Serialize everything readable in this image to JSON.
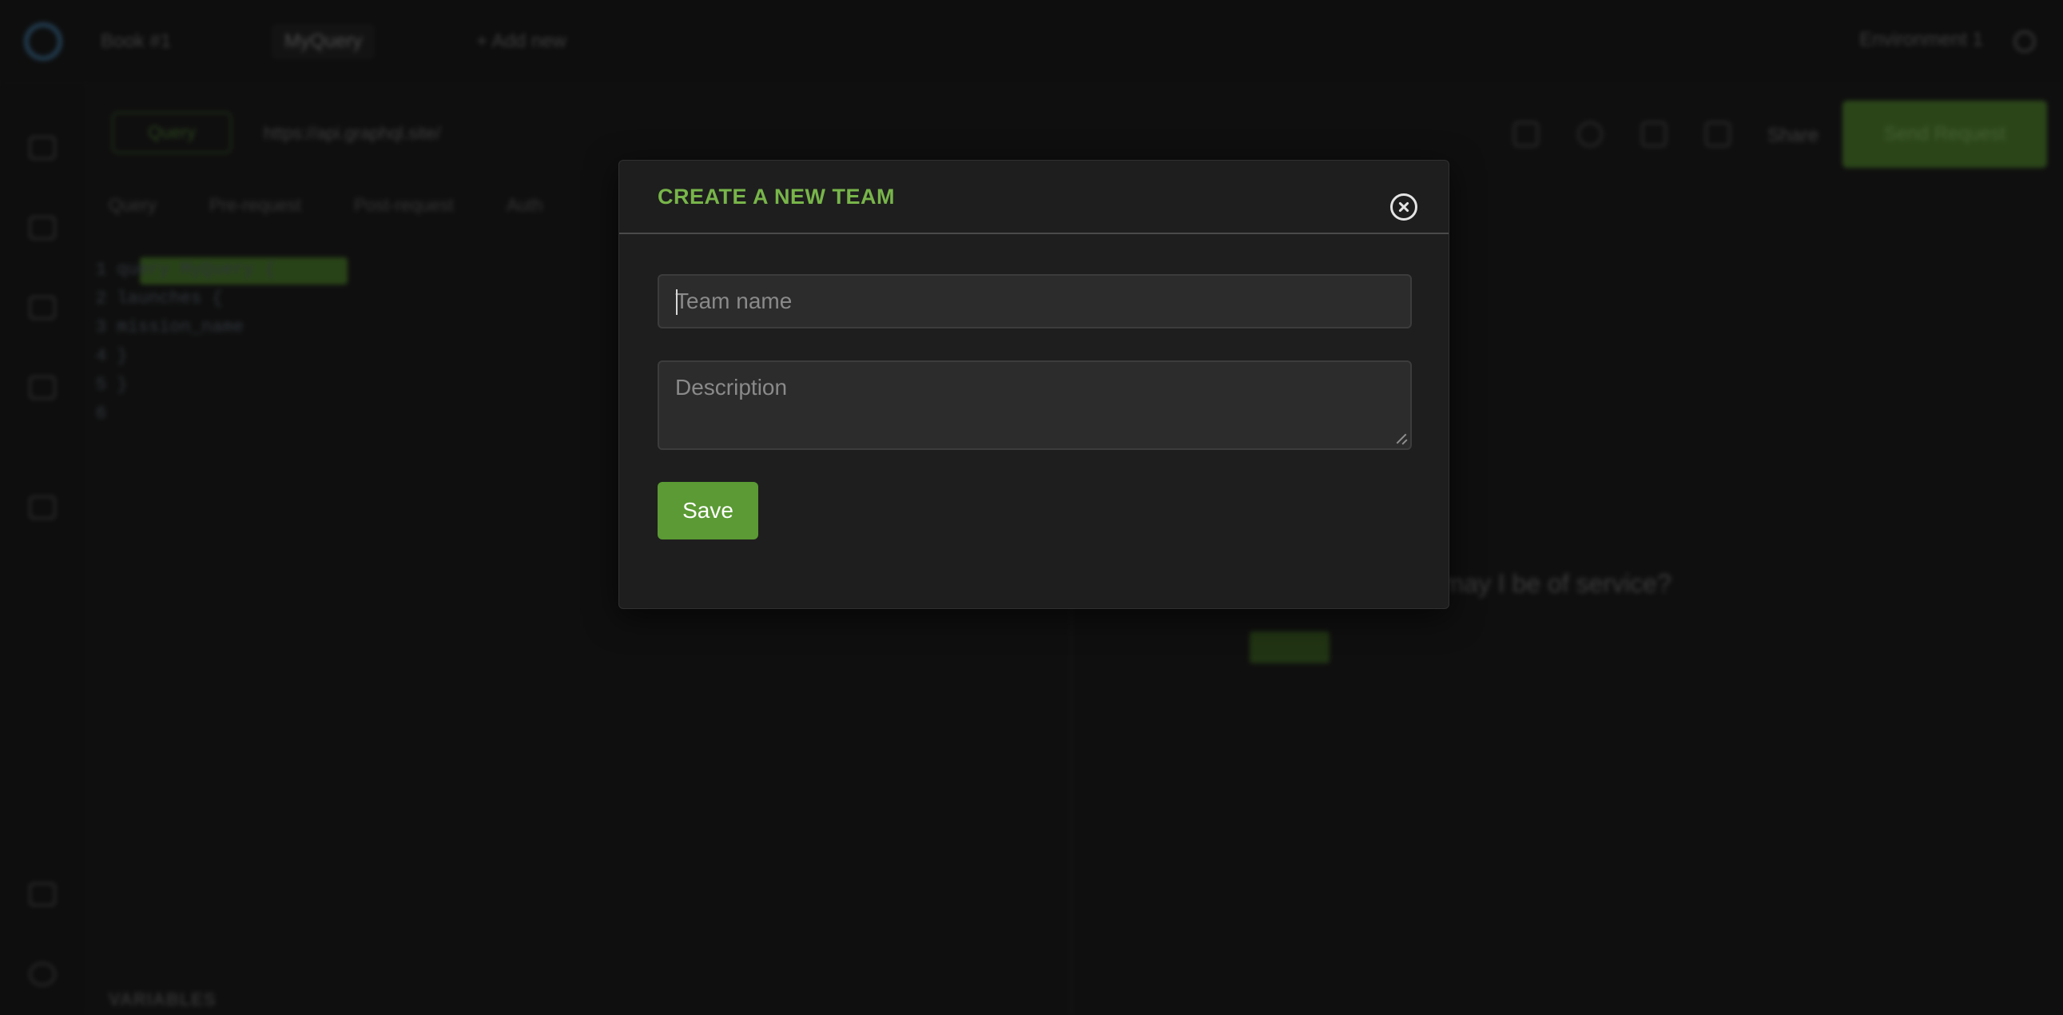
{
  "background": {
    "topbar": {
      "tab1": "Book #1",
      "tab2": "MyQuery",
      "add_new": "+ Add new",
      "environment": "Environment 1"
    },
    "request": {
      "method": "Query",
      "url": "https://api.graphql.site/",
      "share": "Share",
      "send": "Send Request"
    },
    "query_tabs": [
      "Query",
      "Pre-request",
      "Post-request",
      "Auth"
    ],
    "editor_lines": [
      "1  query MyQuery {",
      "2    launches {",
      "3      mission_name",
      "4    }",
      "5  }",
      "6"
    ],
    "response_text": "friend, how may I be of service?",
    "variables_label": "VARIABLES"
  },
  "modal": {
    "title": "CREATE A NEW TEAM",
    "team_name_placeholder": "Team name",
    "team_name_value": "",
    "description_placeholder": "Description",
    "description_value": "",
    "save_label": "Save"
  },
  "colors": {
    "accent": "#78b54a",
    "button": "#5b9a34"
  }
}
